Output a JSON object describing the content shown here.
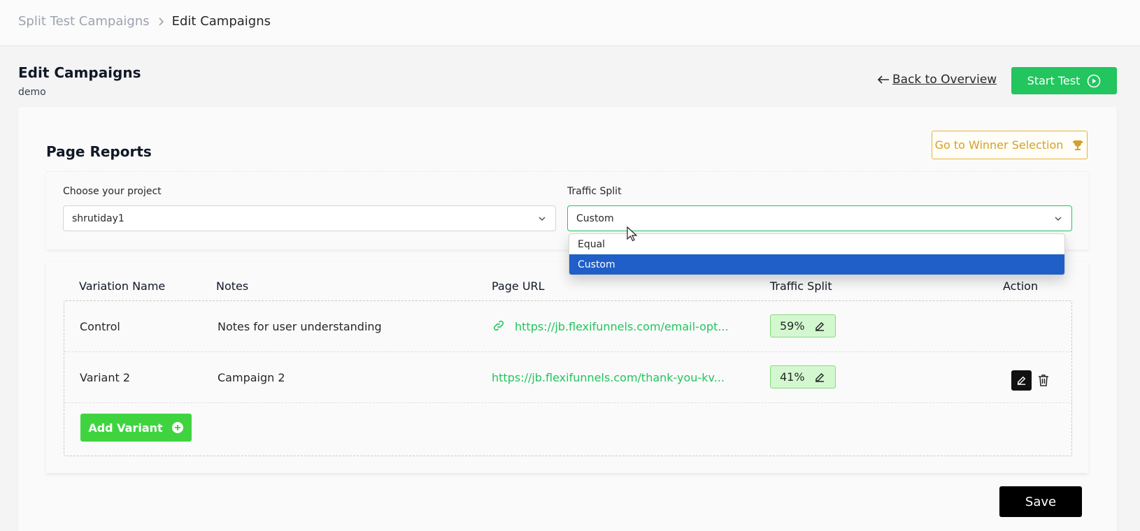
{
  "breadcrumb": {
    "parent": "Split Test Campaigns",
    "current": "Edit Campaigns"
  },
  "header": {
    "title": "Edit Campaigns",
    "subtitle": "demo",
    "back_label": "Back to Overview",
    "start_label": "Start Test"
  },
  "reports": {
    "title": "Page Reports",
    "winner_label": "Go to Winner Selection"
  },
  "filters": {
    "project_label": "Choose your project",
    "project_value": "shrutiday1",
    "split_label": "Traffic Split",
    "split_value": "Custom",
    "split_options": [
      "Equal",
      "Custom"
    ]
  },
  "table": {
    "headers": [
      "Variation Name",
      "Notes",
      "Page URL",
      "Traffic Split",
      "Action"
    ],
    "rows": [
      {
        "name": "Control",
        "notes": "Notes for user understanding",
        "url": "https://jb.flexifunnels.com/email-opt...",
        "split": "59%"
      },
      {
        "name": "Variant 2",
        "notes": "Campaign 2",
        "url": "https://jb.flexifunnels.com/thank-you-kv...",
        "split": "41%"
      }
    ],
    "add_label": "Add Variant"
  },
  "save_label": "Save",
  "colors": {
    "accent_green": "#22c55e",
    "gold": "#d4a12a",
    "selected_blue": "#1f5fc7"
  }
}
